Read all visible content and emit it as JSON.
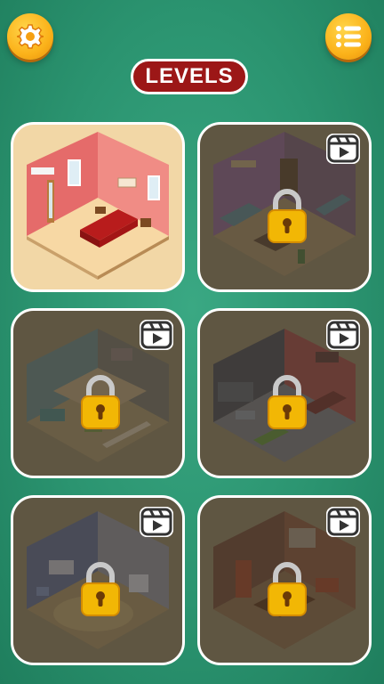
{
  "header": {
    "title": "LEVELS",
    "settings_icon": "gear-icon",
    "menu_icon": "list-menu-icon"
  },
  "colors": {
    "background": "#2b9470",
    "accent_button": "#fbb21a",
    "title_pill": "#9c1717",
    "lock": "#f5b800"
  },
  "levels": [
    {
      "room": "bedroom",
      "status": "unlocked",
      "badge_icon": "none"
    },
    {
      "room": "living-room",
      "status": "locked",
      "badge_icon": "reel-play-icon"
    },
    {
      "room": "two-floor-house",
      "status": "locked",
      "badge_icon": "reel-play-icon"
    },
    {
      "room": "kitchen-and-living",
      "status": "locked",
      "badge_icon": "reel-play-icon"
    },
    {
      "room": "kids-room",
      "status": "locked",
      "badge_icon": "reel-play-icon"
    },
    {
      "room": "dining-room",
      "status": "locked",
      "badge_icon": "reel-play-icon"
    }
  ]
}
